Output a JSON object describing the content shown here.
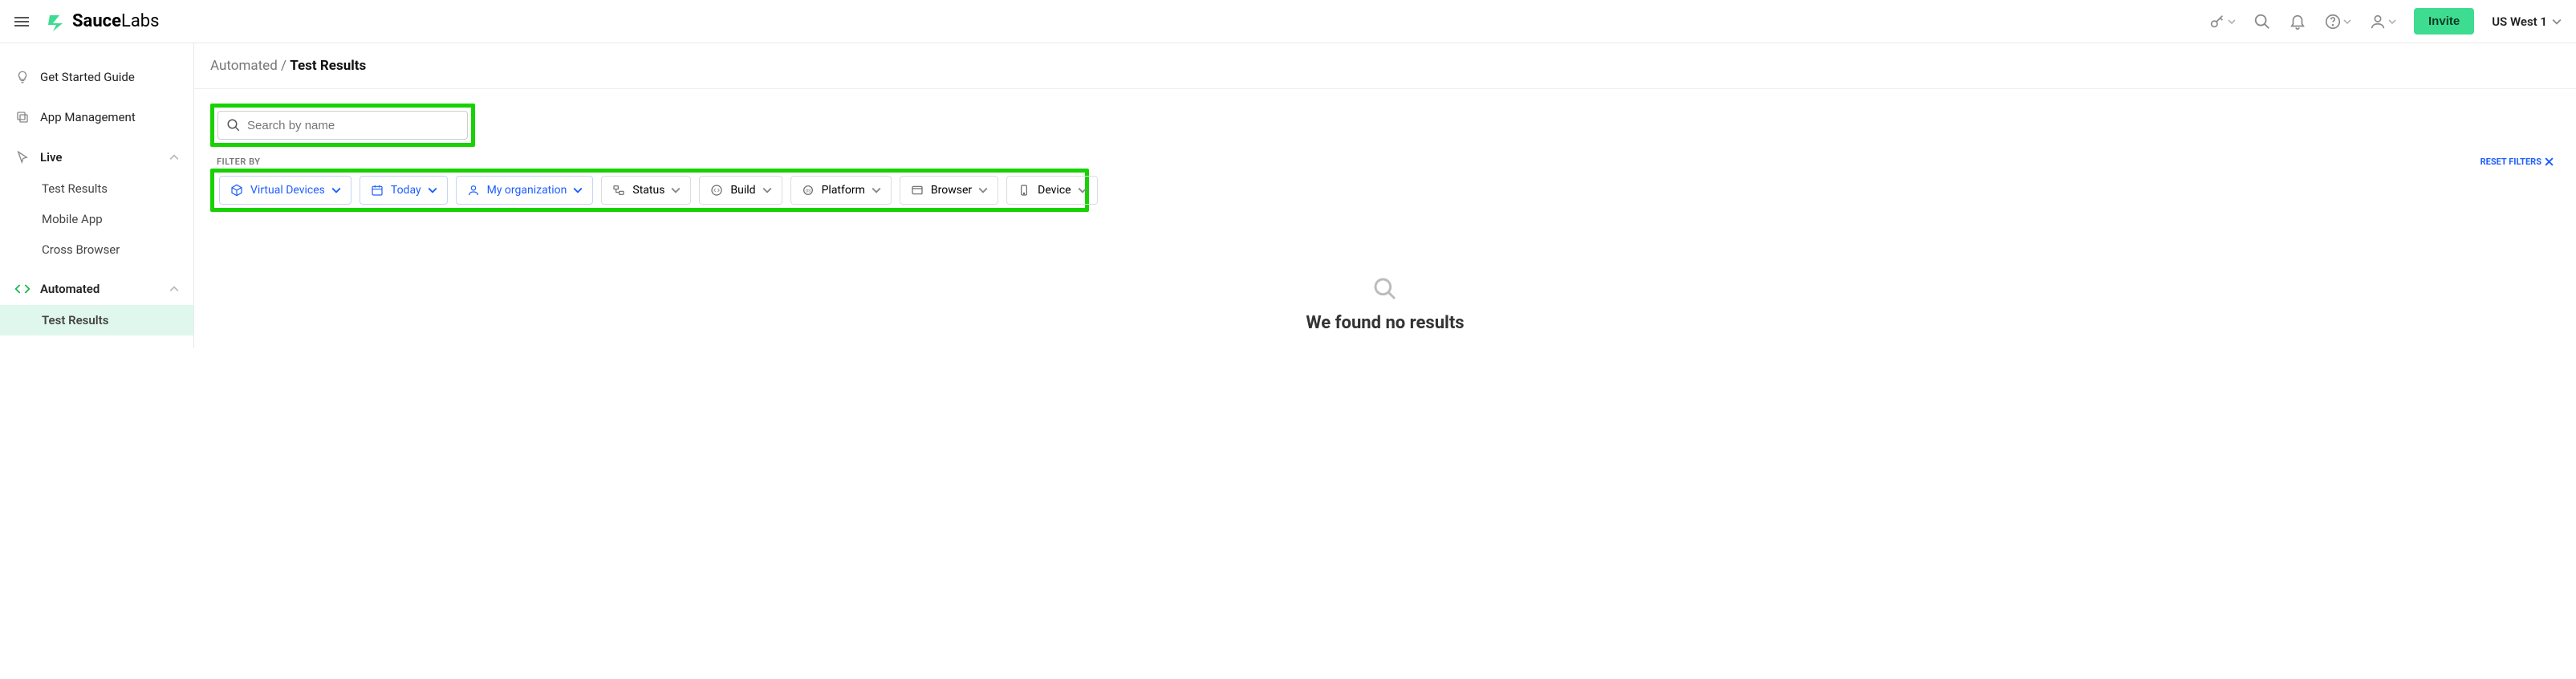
{
  "header": {
    "brand_part1": "Sauce",
    "brand_part2": "Labs",
    "invite_label": "Invite",
    "region_label": "US West 1"
  },
  "sidebar": {
    "get_started": "Get Started Guide",
    "app_management": "App Management",
    "live": "Live",
    "live_children": {
      "test_results": "Test Results",
      "mobile_app": "Mobile App",
      "cross_browser": "Cross Browser"
    },
    "automated": "Automated",
    "automated_children": {
      "test_results": "Test Results"
    }
  },
  "breadcrumb": {
    "parent": "Automated",
    "separator": " / ",
    "current": "Test Results"
  },
  "search": {
    "placeholder": "Search by name"
  },
  "filter_section": {
    "label": "FILTER BY",
    "reset_label": "RESET FILTERS"
  },
  "filters": {
    "virtual_devices": "Virtual Devices",
    "today": "Today",
    "my_org": "My organization",
    "status": "Status",
    "build": "Build",
    "platform": "Platform",
    "browser": "Browser",
    "device": "Device"
  },
  "empty_state": {
    "message": "We found no results"
  }
}
